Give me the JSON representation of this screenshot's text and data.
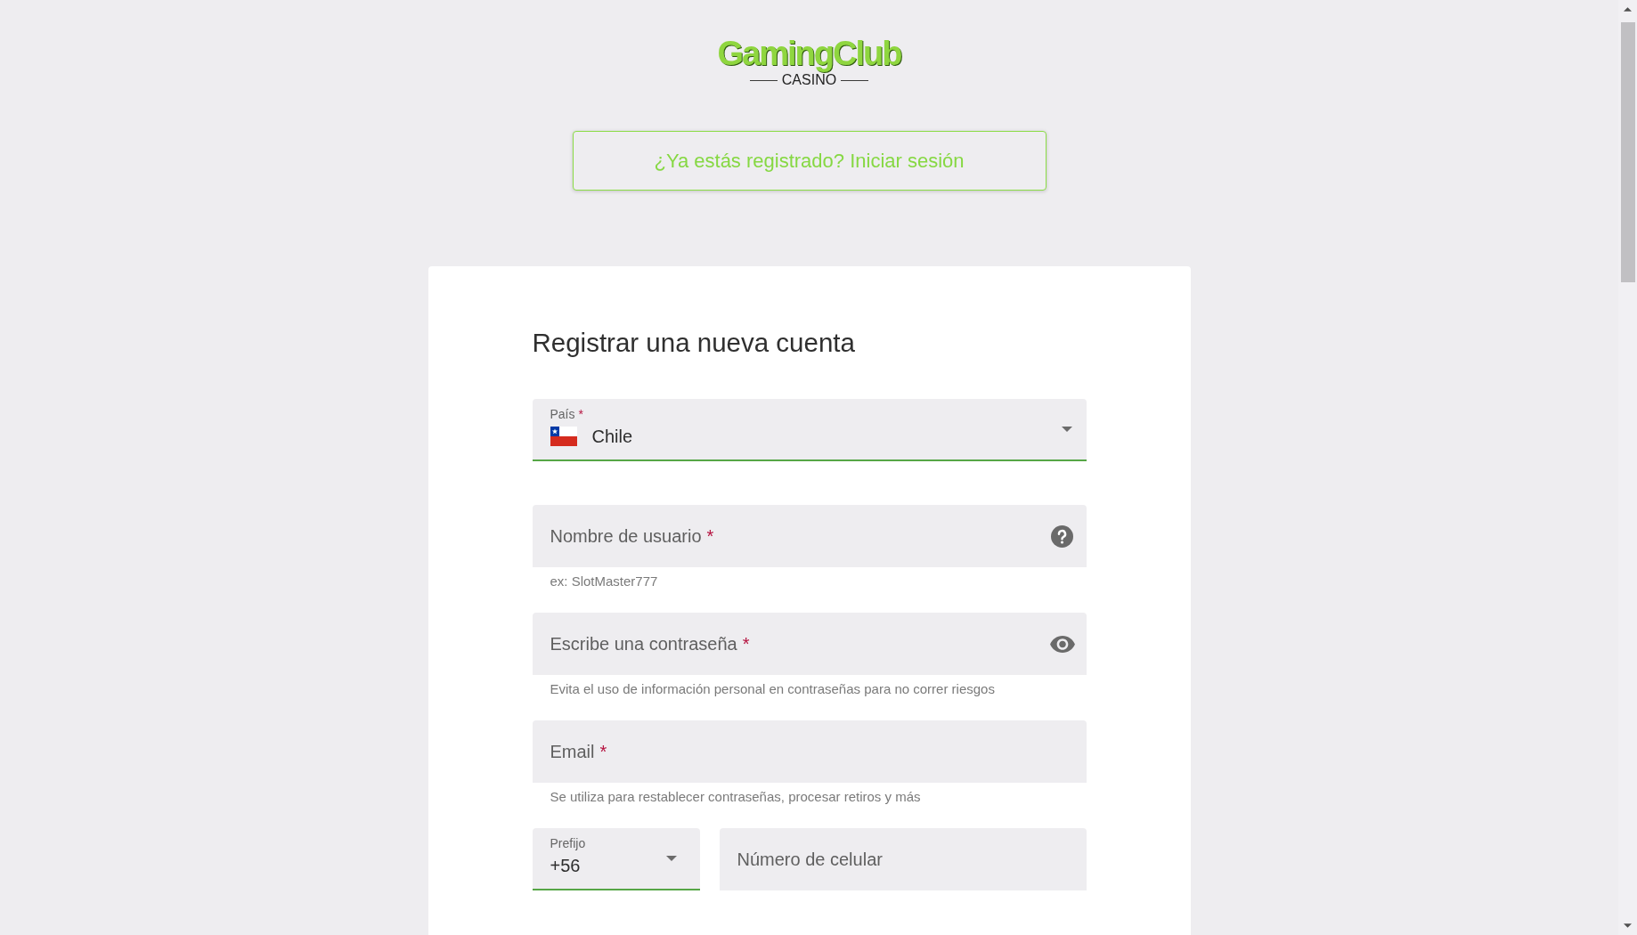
{
  "logo": {
    "title": "GamingClub",
    "subtitle": "CASINO"
  },
  "login_button": {
    "label": "¿Ya estás registrado? Iniciar sesión"
  },
  "registration_form": {
    "title": "Registrar una nueva cuenta",
    "fields": [
      {
        "kind": "country_select",
        "label": "País",
        "required_mark": "*",
        "value": "Chile"
      },
      {
        "kind": "username",
        "placeholder": "Nombre de usuario",
        "required_mark": "*",
        "hint": "ex: SlotMaster777"
      },
      {
        "kind": "password",
        "placeholder": "Escribe una contraseña",
        "required_mark": "*",
        "hint": "Evita el uso de información personal en contraseñas para no correr riesgos"
      },
      {
        "kind": "email",
        "placeholder": "Email",
        "required_mark": "*",
        "hint": "Se utiliza para restablecer contraseñas, procesar retiros y más"
      }
    ],
    "phone": {
      "prefix": {
        "kind": "prefix_select",
        "label": "Prefijo",
        "value": "+56"
      },
      "number": {
        "kind": "phone",
        "placeholder": "Número de celular"
      }
    }
  }
}
